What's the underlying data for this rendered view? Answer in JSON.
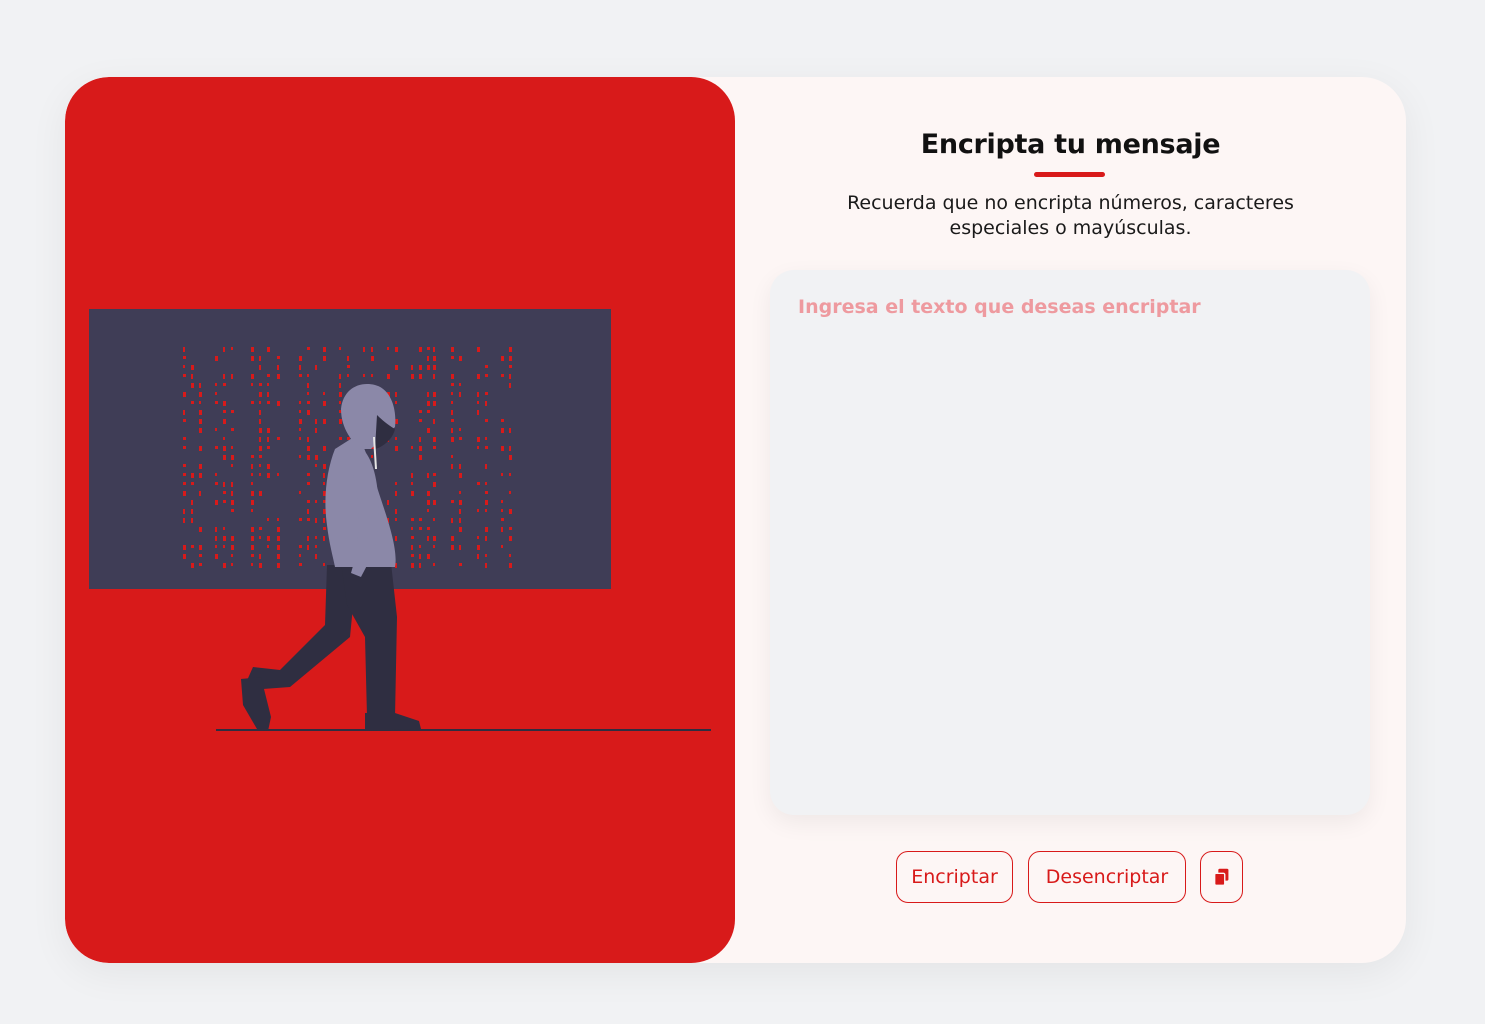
{
  "header": {
    "title": "Encripta tu mensaje",
    "subtitle": "Recuerda que no encripta números, caracteres especiales o mayúsculas."
  },
  "input": {
    "placeholder": "Ingresa el texto que deseas encriptar",
    "value": ""
  },
  "buttons": {
    "encrypt_label": "Encriptar",
    "decrypt_label": "Desencriptar",
    "copy_icon": "copy-icon"
  },
  "colors": {
    "accent": "#d81a1a",
    "background": "#f1f2f4",
    "card": "#fdf6f5",
    "screen": "#3f3d56",
    "hoodie": "#8b88a8",
    "pants": "#2f2e41",
    "placeholder": "#ee9a9f"
  }
}
